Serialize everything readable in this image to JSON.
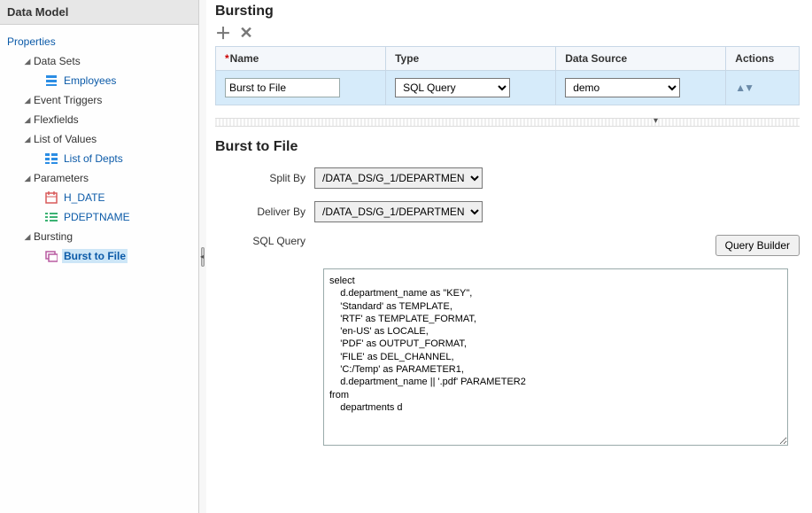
{
  "sidebar": {
    "title": "Data Model",
    "root": "Properties",
    "nodes": {
      "data_sets": "Data Sets",
      "employees": "Employees",
      "event_triggers": "Event Triggers",
      "flexfields": "Flexfields",
      "list_of_values": "List of Values",
      "list_of_depts": "List of Depts",
      "parameters": "Parameters",
      "h_date": "H_DATE",
      "pdeptname": "PDEPTNAME",
      "bursting": "Bursting",
      "burst_to_file": "Burst to File"
    }
  },
  "main": {
    "title": "Bursting",
    "table": {
      "headers": {
        "name": "Name",
        "type": "Type",
        "data_source": "Data Source",
        "actions": "Actions"
      },
      "row": {
        "name_value": "Burst to File",
        "type_value": "SQL Query",
        "data_source_value": "demo"
      }
    },
    "detail": {
      "title": "Burst to File",
      "split_by_label": "Split By",
      "split_by_value": "/DATA_DS/G_1/DEPARTMEN",
      "deliver_by_label": "Deliver By",
      "deliver_by_value": "/DATA_DS/G_1/DEPARTMEN",
      "sql_query_label": "SQL Query",
      "query_builder_label": "Query Builder",
      "sql_text": "select\n    d.department_name as \"KEY\",\n    'Standard' as TEMPLATE,\n    'RTF' as TEMPLATE_FORMAT,\n    'en-US' as LOCALE,\n    'PDF' as OUTPUT_FORMAT,\n    'FILE' as DEL_CHANNEL,\n    'C:/Temp' as PARAMETER1,\n    d.department_name || '.pdf' PARAMETER2\nfrom\n    departments d"
    }
  }
}
